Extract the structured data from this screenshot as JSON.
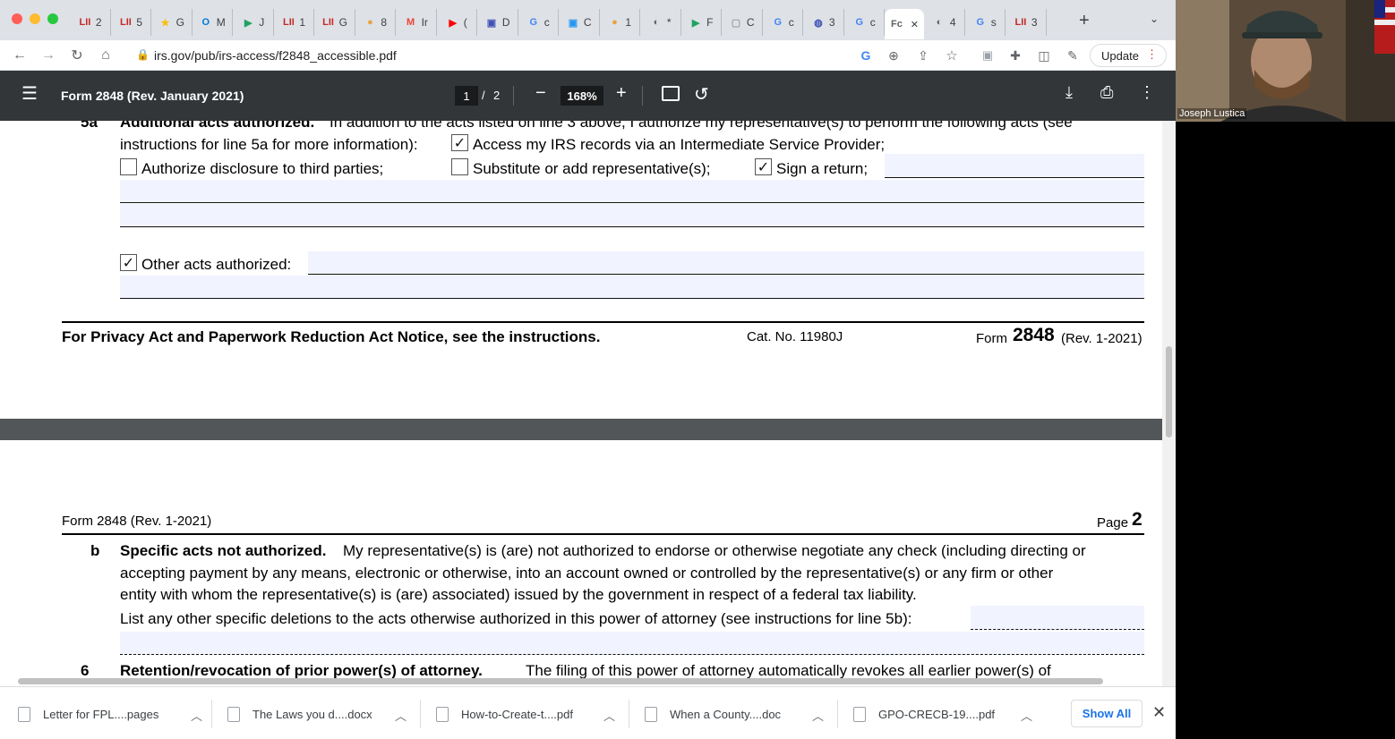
{
  "browser": {
    "tabs": [
      {
        "icon": "LII",
        "label": "2",
        "color": "#c62828"
      },
      {
        "icon": "LII",
        "label": "5",
        "color": "#c62828"
      },
      {
        "icon": "★",
        "label": "G",
        "color": "#fbbc04"
      },
      {
        "icon": "O",
        "label": "M",
        "color": "#0078d4"
      },
      {
        "icon": "▶",
        "label": "J",
        "color": "#1ea362"
      },
      {
        "icon": "LII",
        "label": "1",
        "color": "#c62828"
      },
      {
        "icon": "LII",
        "label": "G",
        "color": "#c62828"
      },
      {
        "icon": "●",
        "label": "8",
        "color": "#e8a33d"
      },
      {
        "icon": "M",
        "label": "Ir",
        "color": "#ea4335"
      },
      {
        "icon": "▶",
        "label": "(",
        "color": "#ff0000"
      },
      {
        "icon": "▣",
        "label": "D",
        "color": "#3f51b5"
      },
      {
        "icon": "G",
        "label": "c",
        "color": "#4285f4"
      },
      {
        "icon": "▣",
        "label": "C",
        "color": "#2196f3"
      },
      {
        "icon": "●",
        "label": "1",
        "color": "#e8a33d"
      },
      {
        "icon": "◐",
        "label": "*",
        "color": "#5f6368"
      },
      {
        "icon": "▶",
        "label": "F",
        "color": "#1ea362"
      },
      {
        "icon": "▢",
        "label": "C",
        "color": "#9e9e9e"
      },
      {
        "icon": "G",
        "label": "c",
        "color": "#4285f4"
      },
      {
        "icon": "◍",
        "label": "3",
        "color": "#3f51b5"
      },
      {
        "icon": "G",
        "label": "c",
        "color": "#4285f4"
      },
      {
        "icon": "Fc",
        "label": "",
        "color": "#5f6368"
      },
      {
        "icon": "◐",
        "label": "4",
        "color": "#5f6368"
      },
      {
        "icon": "G",
        "label": "s",
        "color": "#4285f4"
      },
      {
        "icon": "LII",
        "label": "3",
        "color": "#c62828"
      }
    ],
    "url": "irs.gov/pub/irs-access/f2848_accessible.pdf",
    "update_label": "Update"
  },
  "pdf": {
    "title": "Form 2848 (Rev. January 2021)",
    "page_current": "1",
    "page_sep": "/",
    "page_total": "2",
    "zoom": "168%"
  },
  "page1": {
    "line_num": "5a",
    "line_head": "Additional acts authorized.",
    "line_head_rest": "In addition to the acts listed on line 3 above, I authorize my representative(s) to perform the following acts (see",
    "line_cont": "instructions for line 5a for more information):",
    "opt_ise": "Access my IRS records via an Intermediate Service Provider;",
    "opt_disclose": "Authorize disclosure to third parties;",
    "opt_subst": "Substitute or add representative(s);",
    "opt_sign": "Sign a return;",
    "opt_other": "Other acts authorized:",
    "checked": {
      "ise": true,
      "disclose": false,
      "subst": false,
      "sign": true,
      "other": true
    },
    "footer_privacy": "For Privacy Act and Paperwork Reduction Act Notice, see the instructions.",
    "footer_cat": "Cat. No. 11980J",
    "footer_form": "Form",
    "footer_num": "2848",
    "footer_rev": "(Rev. 1-2021)"
  },
  "page2": {
    "header_left": "Form 2848 (Rev. 1-2021)",
    "header_page": "Page",
    "header_num": "2",
    "b_letter": "b",
    "b_head": "Specific acts not authorized.",
    "b_line1": "My representative(s) is (are) not authorized to endorse or otherwise negotiate any check (including directing or",
    "b_line2": "accepting payment by any means, electronic or otherwise, into an account owned or controlled by the representative(s) or any firm or other",
    "b_line3": "entity with whom the representative(s) is (are) associated) issued by the government in respect of a federal tax liability.",
    "b_list": "List any other specific deletions to the acts otherwise authorized in this power of attorney (see instructions for line 5b):",
    "line6_num": "6",
    "line6_head": "Retention/revocation of prior power(s) of attorney.",
    "line6_rest": "The filing of this power of attorney automatically revokes all earlier power(s) of"
  },
  "downloads": {
    "items": [
      "Letter for FPL....pages",
      "The Laws you d....docx",
      "How-to-Create-t....pdf",
      "When a County....doc",
      "GPO-CRECB-19....pdf"
    ],
    "show_all": "Show All"
  },
  "video": {
    "name": "Joseph Lustica"
  }
}
